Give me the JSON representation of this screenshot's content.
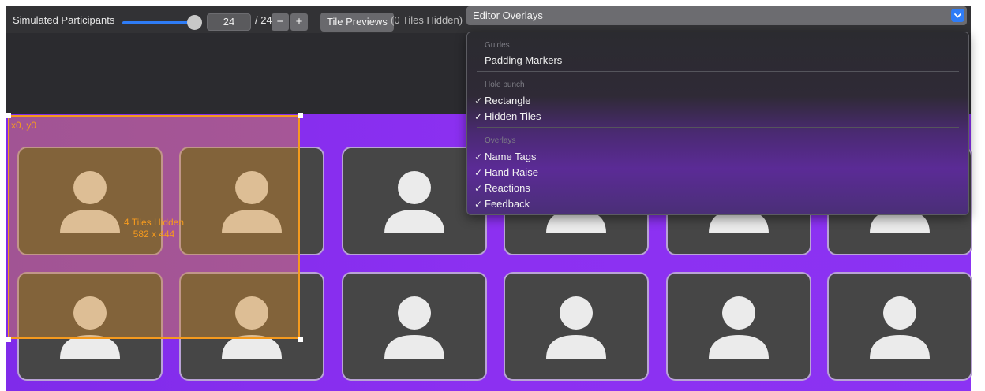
{
  "toolbar": {
    "participants_label": "Simulated Participants",
    "participants_value": "24",
    "participants_total": "/ 24",
    "participants_slider_fraction": 1.0,
    "decrement_label": "−",
    "increment_label": "+",
    "tile_previews_label": "Tile Previews",
    "hidden_count_text": "(0 Tiles Hidden)",
    "overlays_select_value": "Editor Overlays",
    "overlays_select_arrow": "chevron-down-icon"
  },
  "hidden_region": {
    "origin_label": "x0, y0",
    "hidden_tiles_text": "4 Tiles Hidden",
    "size_text": "582 x 444"
  },
  "overlays_menu": {
    "sections": [
      {
        "header": "Guides",
        "items": [
          {
            "label": "Padding Markers",
            "checked": false
          }
        ]
      },
      {
        "header": "Hole punch",
        "items": [
          {
            "label": "Rectangle",
            "checked": true
          },
          {
            "label": "Hidden Tiles",
            "checked": true
          }
        ]
      },
      {
        "header": "Overlays",
        "items": [
          {
            "label": "Name Tags",
            "checked": true
          },
          {
            "label": "Hand Raise",
            "checked": true
          },
          {
            "label": "Reactions",
            "checked": true
          },
          {
            "label": "Feedback",
            "checked": true
          }
        ]
      }
    ],
    "check_glyph": "✓"
  },
  "tiles": {
    "icon": "person-icon",
    "count_visible": 12
  },
  "colors": {
    "accent": "#2e7cf6",
    "stage_purple": "#8a30f0",
    "hidden_overlay": "#f59a1e",
    "tile_bg": "#464646"
  }
}
